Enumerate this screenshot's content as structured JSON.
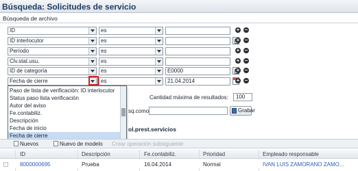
{
  "page": {
    "title": "Búsqueda: Solicitudes de servicio",
    "section_label": "Búsqueda de archivo"
  },
  "criteria": [
    {
      "field": "ID",
      "operator": "es",
      "value": "",
      "value_help": "",
      "actions": [
        "add-icon",
        "remove-icon"
      ]
    },
    {
      "field": "ID interlocutor",
      "operator": "es",
      "value": "",
      "value_help": "value-help-icon",
      "actions": [
        "add-icon",
        "remove-icon"
      ]
    },
    {
      "field": "Período",
      "operator": "es",
      "value": "",
      "value_help": "",
      "actions": [
        "add-icon",
        "remove-icon"
      ]
    },
    {
      "field": "Clv.stat.usu.",
      "operator": "es",
      "value": "",
      "value_help": "",
      "actions": [
        "add-icon",
        "remove-icon"
      ]
    },
    {
      "field": "ID de categoría",
      "operator": "es",
      "value": "E0000",
      "value_help": "value-help-icon",
      "actions": [
        "add-icon",
        "remove-icon"
      ]
    },
    {
      "field": "Fecha de cierre",
      "operator": "es",
      "value": "21.04.2014",
      "value_help": "calendar-icon",
      "actions": [
        "add-icon",
        "remove-icon"
      ]
    }
  ],
  "dropdown": {
    "options": [
      "Paso de lista de verificación: ID interlocutor",
      "Status paso lista verificación",
      "Autor del aviso",
      "Fe.contabiliz.",
      "Descripción",
      "Fecha de inicio",
      "Fecha de cierre"
    ],
    "selected": "Fecha de cierre"
  },
  "search_options": {
    "max_results_label": "Cantidad máxima de resultados:",
    "max_results_value": "100",
    "save_query_label": "sq.como:",
    "save_query_value": "",
    "save_button": "Grabar"
  },
  "results": {
    "title": "ol.prest.servicios",
    "toolbar": {
      "new": "Nuevos",
      "new_from_template": "Nuevo de modelo",
      "create_follow_up": "Crear operación subsiguiente"
    },
    "columns": [
      "ID",
      "Descripción",
      "Fe.contabiliz.",
      "Prioridad",
      "Empleado responsable"
    ],
    "rows": [
      [
        "8000000695",
        "Prueba",
        "16.04.2014",
        "Normal",
        "IVAN LUIS ZAMORANO ZAMO..."
      ]
    ]
  }
}
